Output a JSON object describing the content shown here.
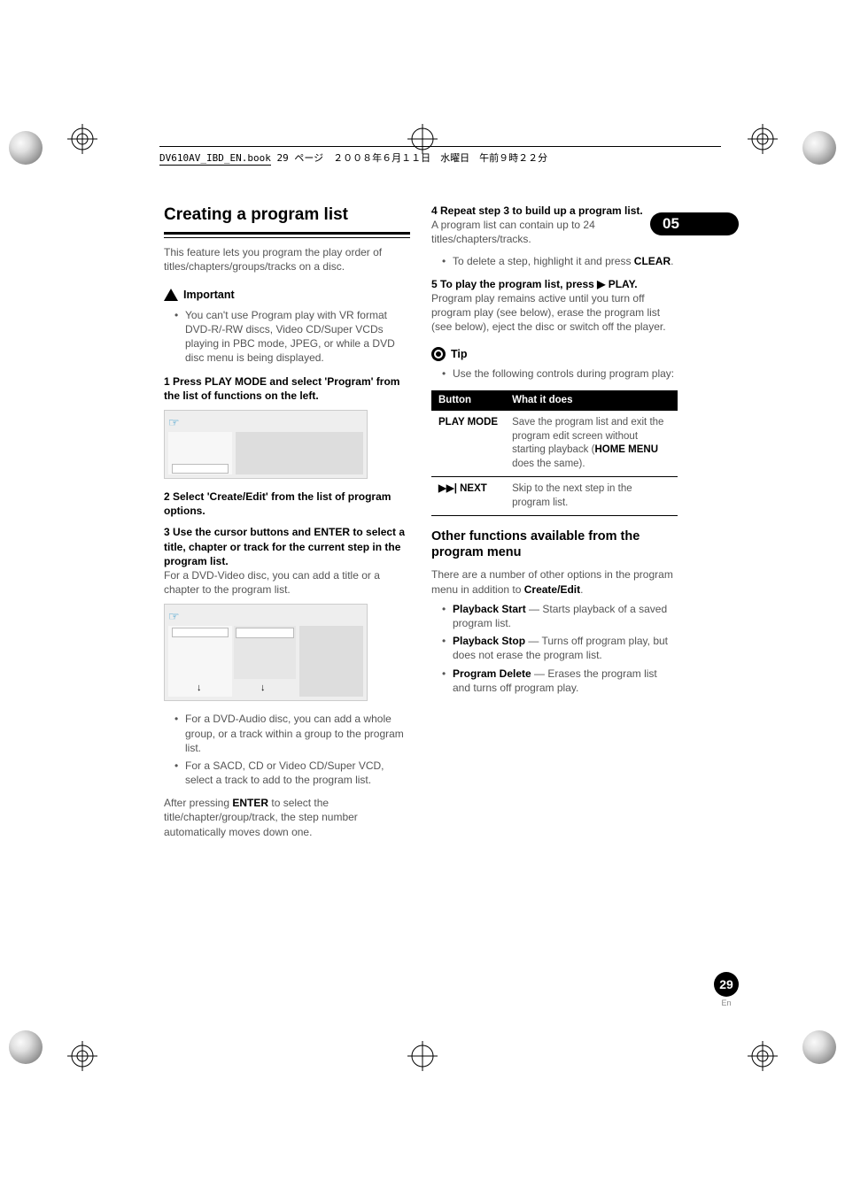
{
  "print_header": {
    "bookname": "DV610AV_IBD_EN.book",
    "pageinfo": "29 ページ　２００８年６月１１日　水曜日　午前９時２２分"
  },
  "chapter_badge": "05",
  "page_number": "29",
  "page_lang": "En",
  "left": {
    "section_title": "Creating a program list",
    "intro": "This feature lets you program the play order of titles/chapters/groups/tracks on a disc.",
    "important_label": "Important",
    "important_items": [
      "You can't use Program play with VR format DVD-R/-RW discs, Video CD/Super VCDs playing in PBC mode, JPEG, or while a DVD disc menu is being displayed."
    ],
    "step1_head": "1    Press PLAY MODE and select 'Program' from the list of functions on the left.",
    "step2_head": "2    Select 'Create/Edit' from the list of program options.",
    "step3_head": "3    Use the cursor buttons and ENTER to select a title, chapter or track for the current step in the program list.",
    "step3_body": "For a DVD-Video disc, you can add a title or a chapter to the program list.",
    "step3_bullets": [
      "For a DVD-Audio disc, you can add a whole group, or a track within a group to the program list.",
      "For a SACD, CD or Video CD/Super VCD, select a track to add to the program list."
    ],
    "step3_tail_a": "After pressing ",
    "step3_tail_b": "ENTER",
    "step3_tail_c": " to select the title/chapter/group/track, the step number automatically moves down one."
  },
  "right": {
    "step4_head": "4    Repeat step 3 to build up a program list.",
    "step4_body": "A program list can contain up to 24 titles/chapters/tracks.",
    "step4_bullet_a": "To delete a step, highlight it and press ",
    "step4_bullet_b": "CLEAR",
    "step4_bullet_c": ".",
    "step5_head": "5    To play the program list, press ▶ PLAY.",
    "step5_body": "Program play remains active until you turn off program play (see below), erase the program list (see below), eject the disc or switch off the player.",
    "tip_label": "Tip",
    "tip_items": [
      "Use the following controls during program play:"
    ],
    "table": {
      "headers": [
        "Button",
        "What it does"
      ],
      "rows": [
        {
          "button": "PLAY MODE",
          "desc_a": "Save the program list and exit the program edit screen without starting playback (",
          "desc_b": "HOME MENU",
          "desc_c": " does the same)."
        },
        {
          "button": "▶▶| NEXT",
          "desc_a": "Skip to the next step in the program list.",
          "desc_b": "",
          "desc_c": ""
        }
      ]
    },
    "subhead": "Other functions available from the program menu",
    "subintro_a": "There are a number of other options in the program menu in addition to ",
    "subintro_b": "Create/Edit",
    "subintro_c": ".",
    "opts": [
      {
        "name": "Playback Start",
        "desc": " — Starts playback of a saved program list."
      },
      {
        "name": "Playback Stop",
        "desc": " — Turns off program play, but does not erase the program list."
      },
      {
        "name": "Program Delete",
        "desc": " — Erases the program list and turns off program play."
      }
    ]
  }
}
